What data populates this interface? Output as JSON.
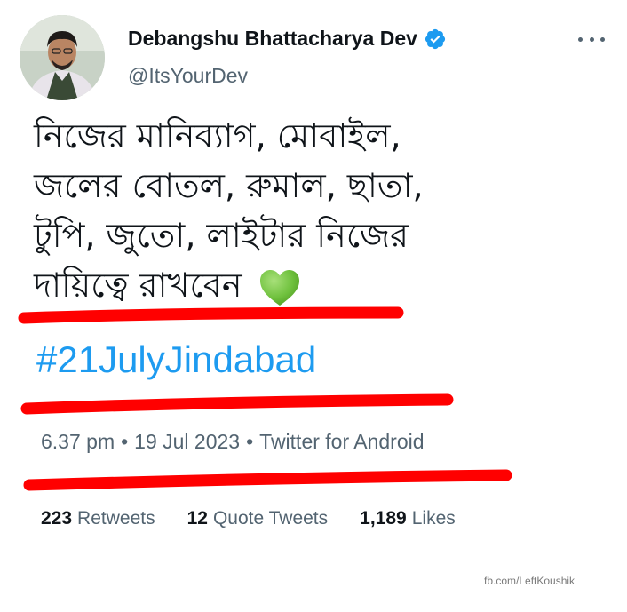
{
  "author": {
    "display_name": "Debangshu Bhattacharya Dev",
    "handle": "@ItsYourDev",
    "verified": true,
    "verified_color": "#1d9bf0"
  },
  "more_icon": "more-horizontal-icon",
  "tweet": {
    "lines": [
      "নিজের মানিব্যাগ, মোবাইল,",
      "জলের বোতল, রুমাল, ছাতা,",
      "টুপি, জুতো, লাইটার নিজের",
      "দায়িত্বে রাখবেন"
    ],
    "emoji_icon": "green-heart-icon",
    "hashtag": "#21JulyJindabad"
  },
  "meta": {
    "time": "6.37 pm",
    "separator": "•",
    "date": "19 Jul 2023",
    "source": "Twitter for Android"
  },
  "stats": {
    "retweets_count": "223",
    "retweets_label": "Retweets",
    "quotes_count": "12",
    "quotes_label": "Quote Tweets",
    "likes_count": "1,189",
    "likes_label": "Likes"
  },
  "annotation_color": "#ff0000",
  "credit": "fb.com/LeftKoushik",
  "colors": {
    "link": "#1d9bf0",
    "secondary_text": "#536471",
    "primary_text": "#0f1419"
  }
}
